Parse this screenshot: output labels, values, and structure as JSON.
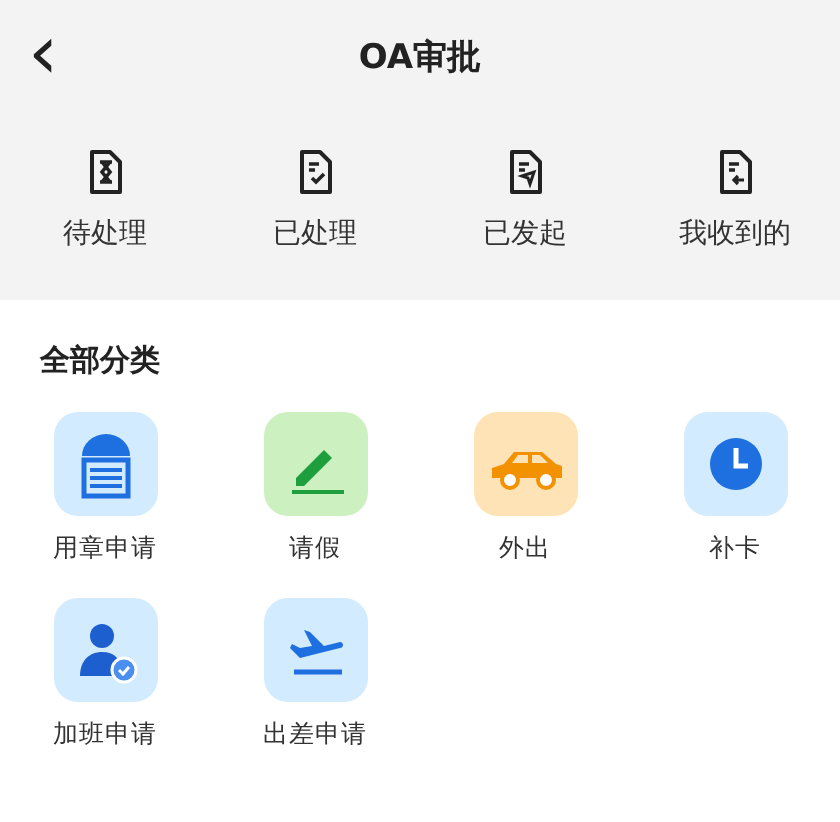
{
  "header": {
    "back": "‹",
    "title": "OA审批"
  },
  "shortcuts": [
    {
      "kind": "pending",
      "label": "待处理"
    },
    {
      "kind": "done",
      "label": "已处理"
    },
    {
      "kind": "sent",
      "label": "已发起"
    },
    {
      "kind": "received",
      "label": "我收到的"
    }
  ],
  "section": {
    "title": "全部分类"
  },
  "categories": [
    {
      "kind": "seal",
      "label": "用章申请"
    },
    {
      "kind": "leave",
      "label": "请假"
    },
    {
      "kind": "outing",
      "label": "外出"
    },
    {
      "kind": "clock",
      "label": "补卡"
    },
    {
      "kind": "overtime",
      "label": "加班申请"
    },
    {
      "kind": "trip",
      "label": "出差申请"
    }
  ]
}
